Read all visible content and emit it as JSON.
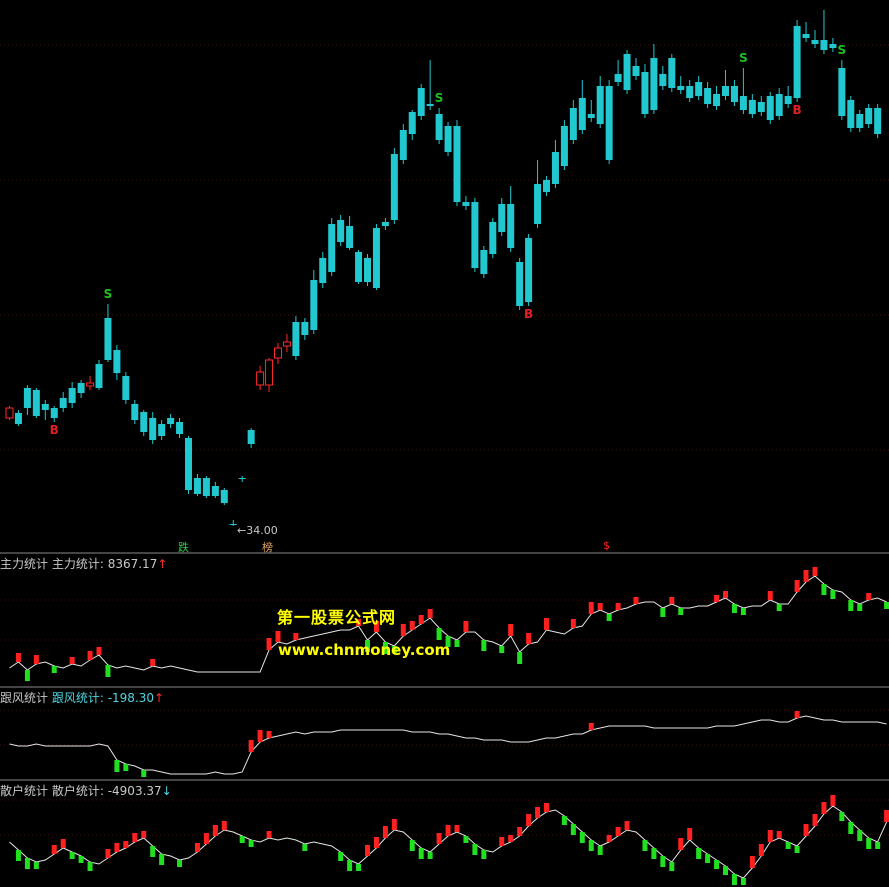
{
  "main": {
    "price_marker": "34.00",
    "tags": [
      {
        "text": "跌",
        "color": "#2ecc40"
      },
      {
        "text": "榜",
        "color": "#e0a060"
      },
      {
        "text": "$",
        "color": "#ff2020"
      }
    ],
    "candles": [
      [
        0,
        418,
        408,
        420,
        406
      ],
      [
        1,
        413,
        424,
        426,
        410
      ],
      [
        2,
        388,
        408,
        415,
        385
      ],
      [
        3,
        390,
        416,
        418,
        388
      ],
      [
        4,
        404,
        410,
        420,
        400
      ],
      [
        5,
        408,
        418,
        422,
        406
      ],
      [
        6,
        398,
        408,
        412,
        392
      ],
      [
        7,
        388,
        403,
        408,
        382
      ],
      [
        8,
        383,
        393,
        398,
        380
      ],
      [
        9,
        386,
        383,
        390,
        376
      ],
      [
        10,
        364,
        388,
        390,
        360
      ],
      [
        11,
        318,
        360,
        362,
        304
      ],
      [
        12,
        350,
        373,
        380,
        345
      ],
      [
        13,
        376,
        400,
        404,
        372
      ],
      [
        14,
        404,
        420,
        424,
        400
      ],
      [
        15,
        412,
        432,
        436,
        410
      ],
      [
        16,
        418,
        440,
        444,
        412
      ],
      [
        17,
        424,
        436,
        440,
        420
      ],
      [
        18,
        418,
        424,
        428,
        414
      ],
      [
        19,
        422,
        434,
        438,
        418
      ],
      [
        20,
        438,
        490,
        494,
        436
      ],
      [
        21,
        478,
        494,
        496,
        474
      ],
      [
        22,
        478,
        496,
        498,
        476
      ],
      [
        23,
        486,
        496,
        498,
        482
      ],
      [
        24,
        490,
        503,
        505,
        488
      ],
      [
        25,
        524,
        524,
        526,
        520
      ],
      [
        26,
        478,
        478,
        482,
        476
      ],
      [
        27,
        430,
        444,
        448,
        428
      ],
      [
        28,
        385,
        372,
        390,
        366
      ],
      [
        29,
        385,
        360,
        392,
        358
      ],
      [
        30,
        358,
        348,
        364,
        343
      ],
      [
        31,
        346,
        342,
        352,
        334
      ],
      [
        32,
        322,
        356,
        360,
        316
      ],
      [
        33,
        322,
        335,
        340,
        318
      ],
      [
        34,
        280,
        330,
        334,
        270
      ],
      [
        35,
        258,
        283,
        288,
        252
      ],
      [
        36,
        224,
        272,
        276,
        218
      ],
      [
        37,
        220,
        242,
        246,
        215
      ],
      [
        38,
        226,
        248,
        250,
        216
      ],
      [
        39,
        252,
        282,
        284,
        250
      ],
      [
        40,
        258,
        282,
        286,
        254
      ],
      [
        41,
        228,
        288,
        290,
        224
      ],
      [
        42,
        222,
        226,
        230,
        218
      ],
      [
        43,
        154,
        220,
        224,
        148
      ],
      [
        44,
        130,
        160,
        164,
        124
      ],
      [
        45,
        112,
        134,
        140,
        110
      ],
      [
        46,
        88,
        116,
        120,
        84
      ],
      [
        47,
        104,
        106,
        110,
        60
      ],
      [
        48,
        114,
        140,
        144,
        108
      ],
      [
        49,
        126,
        152,
        156,
        122
      ],
      [
        50,
        126,
        202,
        206,
        120
      ],
      [
        51,
        202,
        206,
        210,
        196
      ],
      [
        52,
        202,
        268,
        272,
        198
      ],
      [
        53,
        250,
        274,
        278,
        246
      ],
      [
        54,
        222,
        254,
        258,
        218
      ],
      [
        55,
        204,
        232,
        236,
        198
      ],
      [
        56,
        204,
        248,
        252,
        186
      ],
      [
        57,
        262,
        306,
        310,
        258
      ],
      [
        58,
        238,
        302,
        306,
        234
      ],
      [
        59,
        184,
        224,
        228,
        160
      ],
      [
        60,
        180,
        192,
        196,
        176
      ],
      [
        61,
        152,
        184,
        188,
        140
      ],
      [
        62,
        126,
        166,
        170,
        120
      ],
      [
        63,
        108,
        140,
        144,
        100
      ],
      [
        64,
        98,
        130,
        134,
        80
      ],
      [
        65,
        114,
        118,
        122,
        100
      ],
      [
        66,
        86,
        124,
        128,
        76
      ],
      [
        67,
        86,
        160,
        164,
        80
      ],
      [
        68,
        74,
        82,
        86,
        60
      ],
      [
        69,
        54,
        90,
        94,
        50
      ],
      [
        70,
        66,
        76,
        80,
        58
      ],
      [
        71,
        72,
        114,
        118,
        64
      ],
      [
        72,
        58,
        110,
        114,
        44
      ],
      [
        73,
        74,
        86,
        90,
        66
      ],
      [
        74,
        58,
        88,
        92,
        54
      ],
      [
        75,
        86,
        90,
        94,
        76
      ],
      [
        76,
        86,
        98,
        102,
        80
      ],
      [
        77,
        82,
        96,
        100,
        76
      ],
      [
        78,
        88,
        104,
        108,
        82
      ],
      [
        79,
        94,
        106,
        110,
        86
      ],
      [
        80,
        86,
        96,
        100,
        70
      ],
      [
        81,
        86,
        102,
        106,
        80
      ],
      [
        82,
        96,
        110,
        114,
        68
      ],
      [
        83,
        100,
        114,
        118,
        94
      ],
      [
        84,
        102,
        112,
        116,
        96
      ],
      [
        85,
        96,
        120,
        124,
        92
      ],
      [
        86,
        94,
        116,
        120,
        88
      ],
      [
        87,
        96,
        104,
        108,
        86
      ],
      [
        88,
        26,
        98,
        102,
        20
      ],
      [
        89,
        34,
        38,
        42,
        22
      ],
      [
        90,
        40,
        44,
        48,
        30
      ],
      [
        91,
        40,
        50,
        54,
        10
      ],
      [
        92,
        44,
        48,
        52,
        38
      ],
      [
        93,
        68,
        116,
        120,
        60
      ],
      [
        94,
        100,
        128,
        132,
        96
      ],
      [
        95,
        114,
        128,
        132,
        110
      ],
      [
        96,
        108,
        124,
        128,
        104
      ],
      [
        97,
        108,
        134,
        138,
        104
      ]
    ],
    "signals": [
      {
        "idx": 11,
        "text": "S",
        "color": "#20c020",
        "pos": "above"
      },
      {
        "idx": 5,
        "text": "B",
        "color": "#e02020",
        "pos": "below"
      },
      {
        "idx": 48,
        "text": "S",
        "color": "#20c020",
        "pos": "above"
      },
      {
        "idx": 58,
        "text": "B",
        "color": "#e02020",
        "pos": "below"
      },
      {
        "idx": 82,
        "text": "S",
        "color": "#20c020",
        "pos": "above"
      },
      {
        "idx": 88,
        "text": "B",
        "color": "#e02020",
        "pos": "below"
      },
      {
        "idx": 93,
        "text": "S",
        "color": "#20c020",
        "pos": "above"
      }
    ]
  },
  "panels": [
    {
      "name": "主力统计",
      "label": "主力统计: ",
      "value": "8367.17",
      "arrow": "↑",
      "label_color": "#c8c8c8",
      "arrow_color": "#ff3030",
      "series": [
        668,
        662,
        670,
        664,
        662,
        666,
        668,
        664,
        666,
        660,
        655,
        665,
        668,
        666,
        668,
        670,
        666,
        668,
        666,
        668,
        670,
        672,
        672,
        672,
        672,
        672,
        672,
        672,
        672,
        650,
        642,
        644,
        640,
        638,
        636,
        634,
        632,
        630,
        630,
        626,
        640,
        632,
        642,
        646,
        636,
        630,
        624,
        618,
        628,
        636,
        640,
        632,
        632,
        640,
        642,
        646,
        636,
        652,
        644,
        642,
        630,
        632,
        634,
        628,
        626,
        614,
        610,
        614,
        610,
        608,
        604,
        602,
        602,
        608,
        604,
        608,
        608,
        606,
        606,
        602,
        598,
        604,
        608,
        606,
        606,
        600,
        604,
        604,
        592,
        582,
        576,
        584,
        590,
        592,
        600,
        604,
        600,
        598,
        602
      ]
    },
    {
      "name": "跟风统计",
      "label": "跟风统计: ",
      "value": "-198.30",
      "arrow": "↑",
      "label_color": "#4fd6e0",
      "arrow_color": "#ff3030",
      "series": [
        744,
        746,
        746,
        744,
        746,
        746,
        746,
        746,
        746,
        746,
        744,
        746,
        760,
        764,
        766,
        770,
        770,
        772,
        774,
        774,
        774,
        774,
        774,
        772,
        774,
        774,
        772,
        752,
        742,
        738,
        736,
        734,
        732,
        734,
        732,
        732,
        732,
        730,
        730,
        730,
        730,
        730,
        730,
        730,
        730,
        732,
        732,
        732,
        734,
        734,
        736,
        738,
        738,
        740,
        740,
        740,
        742,
        742,
        742,
        740,
        738,
        738,
        736,
        734,
        734,
        730,
        728,
        726,
        726,
        726,
        726,
        726,
        728,
        728,
        728,
        728,
        728,
        728,
        728,
        726,
        726,
        726,
        724,
        722,
        720,
        720,
        722,
        722,
        718,
        716,
        718,
        720,
        720,
        722,
        722,
        722,
        722,
        722,
        724
      ]
    },
    {
      "name": "散户统计",
      "label": "散户统计: ",
      "value": "-4903.37",
      "arrow": "↓",
      "label_color": "#c8c8c8",
      "arrow_color": "#4fd6e0",
      "series": [
        842,
        850,
        858,
        862,
        860,
        854,
        848,
        852,
        856,
        862,
        864,
        858,
        852,
        848,
        842,
        838,
        846,
        854,
        856,
        860,
        858,
        852,
        844,
        836,
        830,
        832,
        836,
        840,
        842,
        838,
        840,
        838,
        840,
        844,
        842,
        844,
        846,
        852,
        860,
        864,
        856,
        848,
        838,
        830,
        832,
        840,
        848,
        852,
        844,
        836,
        832,
        836,
        844,
        850,
        852,
        846,
        842,
        836,
        826,
        818,
        812,
        810,
        816,
        824,
        832,
        840,
        846,
        842,
        836,
        830,
        832,
        840,
        848,
        856,
        862,
        850,
        840,
        848,
        854,
        860,
        866,
        874,
        878,
        868,
        856,
        842,
        838,
        842,
        846,
        836,
        826,
        814,
        806,
        812,
        822,
        830,
        838,
        842,
        822
      ]
    }
  ]
}
